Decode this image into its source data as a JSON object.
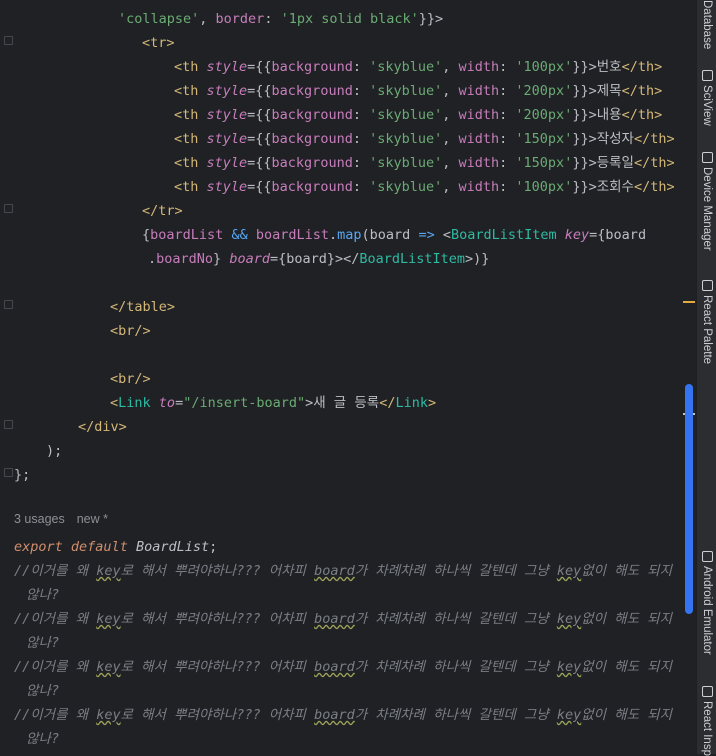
{
  "editor": {
    "lines": [
      [
        {
          "c": "str",
          "t": "'collapse'"
        },
        {
          "c": "plain",
          "t": ", "
        },
        {
          "c": "prop",
          "t": "border"
        },
        {
          "c": "plain",
          "t": ": "
        },
        {
          "c": "str",
          "t": "'1px solid black'"
        },
        {
          "c": "plain",
          "t": "}}>"
        }
      ],
      [
        {
          "c": "tag",
          "t": "<"
        },
        {
          "c": "tag",
          "t": "tr"
        },
        {
          "c": "tag",
          "t": ">"
        }
      ],
      [
        {
          "c": "tag",
          "t": "<th "
        },
        {
          "c": "attr-i",
          "t": "style"
        },
        {
          "c": "plain",
          "t": "={{"
        },
        {
          "c": "prop",
          "t": "background"
        },
        {
          "c": "plain",
          "t": ": "
        },
        {
          "c": "str",
          "t": "'skyblue'"
        },
        {
          "c": "plain",
          "t": ", "
        },
        {
          "c": "prop",
          "t": "width"
        },
        {
          "c": "plain",
          "t": ": "
        },
        {
          "c": "str",
          "t": "'100px'"
        },
        {
          "c": "plain",
          "t": "}}>번호"
        },
        {
          "c": "tag",
          "t": "</th>"
        }
      ],
      [
        {
          "c": "tag",
          "t": "<th "
        },
        {
          "c": "attr-i",
          "t": "style"
        },
        {
          "c": "plain",
          "t": "={{"
        },
        {
          "c": "prop",
          "t": "background"
        },
        {
          "c": "plain",
          "t": ": "
        },
        {
          "c": "str",
          "t": "'skyblue'"
        },
        {
          "c": "plain",
          "t": ", "
        },
        {
          "c": "prop",
          "t": "width"
        },
        {
          "c": "plain",
          "t": ": "
        },
        {
          "c": "str",
          "t": "'200px'"
        },
        {
          "c": "plain",
          "t": "}}>제목"
        },
        {
          "c": "tag",
          "t": "</th>"
        }
      ],
      [
        {
          "c": "tag",
          "t": "<th "
        },
        {
          "c": "attr-i",
          "t": "style"
        },
        {
          "c": "plain",
          "t": "={{"
        },
        {
          "c": "prop",
          "t": "background"
        },
        {
          "c": "plain",
          "t": ": "
        },
        {
          "c": "str",
          "t": "'skyblue'"
        },
        {
          "c": "plain",
          "t": ", "
        },
        {
          "c": "prop",
          "t": "width"
        },
        {
          "c": "plain",
          "t": ": "
        },
        {
          "c": "str",
          "t": "'200px'"
        },
        {
          "c": "plain",
          "t": "}}>내용"
        },
        {
          "c": "tag",
          "t": "</th>"
        }
      ],
      [
        {
          "c": "tag",
          "t": "<th "
        },
        {
          "c": "attr-i",
          "t": "style"
        },
        {
          "c": "plain",
          "t": "={{"
        },
        {
          "c": "prop",
          "t": "background"
        },
        {
          "c": "plain",
          "t": ": "
        },
        {
          "c": "str",
          "t": "'skyblue'"
        },
        {
          "c": "plain",
          "t": ", "
        },
        {
          "c": "prop",
          "t": "width"
        },
        {
          "c": "plain",
          "t": ": "
        },
        {
          "c": "str",
          "t": "'150px'"
        },
        {
          "c": "plain",
          "t": "}}>작성자"
        },
        {
          "c": "tag",
          "t": "</th>"
        }
      ],
      [
        {
          "c": "tag",
          "t": "<th "
        },
        {
          "c": "attr-i",
          "t": "style"
        },
        {
          "c": "plain",
          "t": "={{"
        },
        {
          "c": "prop",
          "t": "background"
        },
        {
          "c": "plain",
          "t": ": "
        },
        {
          "c": "str",
          "t": "'skyblue'"
        },
        {
          "c": "plain",
          "t": ", "
        },
        {
          "c": "prop",
          "t": "width"
        },
        {
          "c": "plain",
          "t": ": "
        },
        {
          "c": "str",
          "t": "'150px'"
        },
        {
          "c": "plain",
          "t": "}}>등록일"
        },
        {
          "c": "tag",
          "t": "</th>"
        }
      ],
      [
        {
          "c": "tag",
          "t": "<th "
        },
        {
          "c": "attr-i",
          "t": "style"
        },
        {
          "c": "plain",
          "t": "={{"
        },
        {
          "c": "prop",
          "t": "background"
        },
        {
          "c": "plain",
          "t": ": "
        },
        {
          "c": "str",
          "t": "'skyblue'"
        },
        {
          "c": "plain",
          "t": ", "
        },
        {
          "c": "prop",
          "t": "width"
        },
        {
          "c": "plain",
          "t": ": "
        },
        {
          "c": "str",
          "t": "'100px'"
        },
        {
          "c": "plain",
          "t": "}}>조회수"
        },
        {
          "c": "tag",
          "t": "</th>"
        }
      ],
      [
        {
          "c": "tag",
          "t": "</tr>"
        }
      ],
      [
        {
          "c": "plain",
          "t": "{"
        },
        {
          "c": "prop",
          "t": "boardList"
        },
        {
          "c": "plain",
          "t": " "
        },
        {
          "c": "fn",
          "t": "&&"
        },
        {
          "c": "plain",
          "t": " "
        },
        {
          "c": "prop",
          "t": "boardList"
        },
        {
          "c": "plain",
          "t": "."
        },
        {
          "c": "fn",
          "t": "map"
        },
        {
          "c": "plain",
          "t": "(board "
        },
        {
          "c": "fn",
          "t": "=>"
        },
        {
          "c": "plain",
          "t": " <"
        },
        {
          "c": "cls",
          "t": "BoardListItem"
        },
        {
          "c": "plain",
          "t": " "
        },
        {
          "c": "attr-i",
          "t": "key"
        },
        {
          "c": "plain",
          "t": "={board"
        }
      ],
      [
        {
          "c": "plain",
          "t": "."
        },
        {
          "c": "prop",
          "t": "boardNo"
        },
        {
          "c": "plain",
          "t": "} "
        },
        {
          "c": "attr-i",
          "t": "board"
        },
        {
          "c": "plain",
          "t": "={board}></"
        },
        {
          "c": "cls",
          "t": "BoardListItem"
        },
        {
          "c": "plain",
          "t": ">)}"
        }
      ],
      [],
      [
        {
          "c": "tag",
          "t": "</table>"
        }
      ],
      [
        {
          "c": "tag",
          "t": "<br/>"
        }
      ],
      [],
      [
        {
          "c": "tag",
          "t": "<br/>"
        }
      ],
      [
        {
          "c": "tag",
          "t": "<"
        },
        {
          "c": "cls",
          "t": "Link"
        },
        {
          "c": "plain",
          "t": " "
        },
        {
          "c": "attr-i",
          "t": "to"
        },
        {
          "c": "plain",
          "t": "="
        },
        {
          "c": "str",
          "t": "\"/insert-board\""
        },
        {
          "c": "plain",
          "t": ">새 글 등록"
        },
        {
          "c": "tag",
          "t": "</"
        },
        {
          "c": "cls",
          "t": "Link"
        },
        {
          "c": "tag",
          "t": ">"
        }
      ],
      [
        {
          "c": "tag",
          "t": "</div>"
        }
      ],
      [
        {
          "c": "plain",
          "t": ");"
        }
      ],
      [
        {
          "c": "plain",
          "t": "};"
        }
      ],
      [],
      [],
      [
        {
          "c": "kw",
          "t": "export"
        },
        {
          "c": "plain",
          "t": " "
        },
        {
          "c": "kw",
          "t": "default"
        },
        {
          "c": "plain",
          "t": " "
        },
        {
          "c": "cls-name",
          "t": "BoardList"
        },
        {
          "c": "plain",
          "t": ";"
        }
      ],
      [
        {
          "c": "cmt",
          "t": "//이거를 왜 "
        },
        {
          "c": "cmt cmt-u",
          "t": "key"
        },
        {
          "c": "cmt",
          "t": "로 해서 뿌려야하나??? 어차피 "
        },
        {
          "c": "cmt cmt-u",
          "t": "board"
        },
        {
          "c": "cmt",
          "t": "가 차례차례 하나씩 갈텐데 그냥 "
        },
        {
          "c": "cmt cmt-u",
          "t": "key"
        },
        {
          "c": "cmt",
          "t": "없이 해도 되지"
        }
      ],
      [
        {
          "c": "cmt",
          "t": " 않나?"
        }
      ],
      [
        {
          "c": "cmt",
          "t": "//이거를 왜 "
        },
        {
          "c": "cmt cmt-u",
          "t": "key"
        },
        {
          "c": "cmt",
          "t": "로 해서 뿌려야하나??? 어차피 "
        },
        {
          "c": "cmt cmt-u",
          "t": "board"
        },
        {
          "c": "cmt",
          "t": "가 차례차례 하나씩 갈텐데 그냥 "
        },
        {
          "c": "cmt cmt-u",
          "t": "key"
        },
        {
          "c": "cmt",
          "t": "없이 해도 되지"
        }
      ],
      [
        {
          "c": "cmt",
          "t": " 않나?"
        }
      ],
      [
        {
          "c": "cmt",
          "t": "//이거를 왜 "
        },
        {
          "c": "cmt cmt-u",
          "t": "key"
        },
        {
          "c": "cmt",
          "t": "로 해서 뿌려야하나??? 어차피 "
        },
        {
          "c": "cmt cmt-u",
          "t": "board"
        },
        {
          "c": "cmt",
          "t": "가 차례차례 하나씩 갈텐데 그냥 "
        },
        {
          "c": "cmt cmt-u",
          "t": "key"
        },
        {
          "c": "cmt",
          "t": "없이 해도 되지"
        }
      ],
      [
        {
          "c": "cmt",
          "t": " 않나?"
        }
      ],
      [
        {
          "c": "cmt",
          "t": "//이거를 왜 "
        },
        {
          "c": "cmt cmt-u",
          "t": "key"
        },
        {
          "c": "cmt",
          "t": "로 해서 뿌려야하나??? 어차피 "
        },
        {
          "c": "cmt cmt-u",
          "t": "board"
        },
        {
          "c": "cmt",
          "t": "가 차례차례 하나씩 갈텐데 그냥 "
        },
        {
          "c": "cmt cmt-u",
          "t": "key"
        },
        {
          "c": "cmt",
          "t": "없이 해도 되지"
        }
      ],
      [
        {
          "c": "cmt",
          "t": " 않나?"
        }
      ]
    ]
  },
  "inlay": {
    "usages": "3 usages",
    "author": "new *"
  },
  "right_toolbar": {
    "tabs": [
      {
        "label": "Database",
        "icon": "database-icon"
      },
      {
        "label": "SciView",
        "icon": "sciview-icon"
      },
      {
        "label": "Device Manager",
        "icon": "device-manager-icon"
      },
      {
        "label": "React Palette",
        "icon": "react-palette-icon"
      },
      {
        "label": "Android Emulator",
        "icon": "android-emulator-icon"
      },
      {
        "label": "React Insp",
        "icon": "react-inspector-icon"
      }
    ]
  },
  "colors": {
    "background": "#1f2124",
    "scrollbar_thumb": "#3574f0",
    "marker_warning": "#e5a93d",
    "marker_info": "#c8c8c8"
  }
}
